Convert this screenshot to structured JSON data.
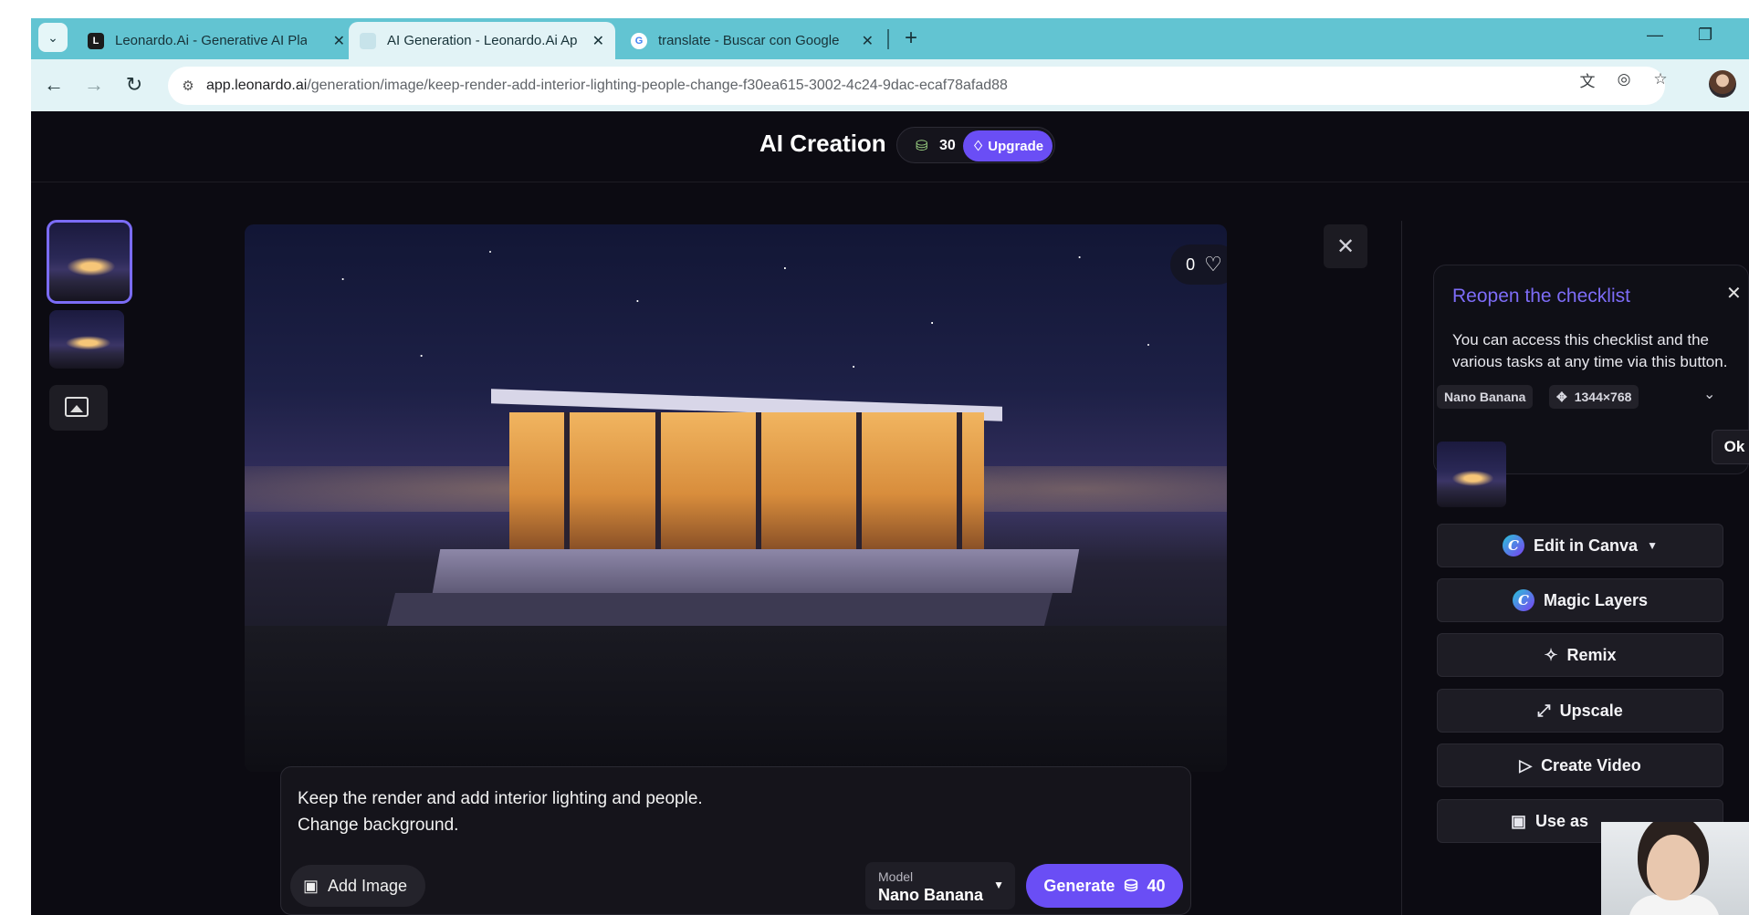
{
  "browser": {
    "tabs": [
      {
        "title": "Leonardo.Ai - Generative AI Pla",
        "favicon": "leonardo-icon"
      },
      {
        "title": "AI Generation - Leonardo.Ai Ap",
        "favicon": "leonardo-icon"
      },
      {
        "title": "translate - Buscar con Google",
        "favicon": "google-icon"
      }
    ],
    "url_host": "app.leonardo.ai",
    "url_path": "/generation/image/keep-render-add-interior-lighting-people-change-f30ea615-3002-4c24-9dac-ecaf78afad88"
  },
  "app": {
    "title": "AI Creation",
    "credits": "30",
    "upgrade_label": "Upgrade"
  },
  "image": {
    "likes": "0"
  },
  "prompt": {
    "text": "Keep the render and add interior lighting and people.\nChange background.",
    "add_image_label": "Add Image",
    "model_label": "Model",
    "model_value": "Nano Banana",
    "generate_label": "Generate",
    "generate_cost": "40"
  },
  "checklist_popover": {
    "title": "Reopen the checklist",
    "body": "You can access this checklist and the various tasks at any time via this button.",
    "ok_label": "Ok"
  },
  "details": {
    "model_tag": "Nano Banana",
    "dimensions": "1344×768"
  },
  "actions": [
    {
      "label": "Edit in Canva",
      "icon": "canva-icon"
    },
    {
      "label": "Magic Layers",
      "icon": "canva-icon"
    },
    {
      "label": "Remix",
      "icon": "magic-wand-icon"
    },
    {
      "label": "Upscale",
      "icon": "upscale-icon"
    },
    {
      "label": "Create Video",
      "icon": "play-icon"
    },
    {
      "label": "Use as",
      "icon": "image-add-icon"
    }
  ],
  "colors": {
    "accent": "#6a4ef5",
    "tabbar": "#62c4d2",
    "background": "#0c0b12"
  }
}
